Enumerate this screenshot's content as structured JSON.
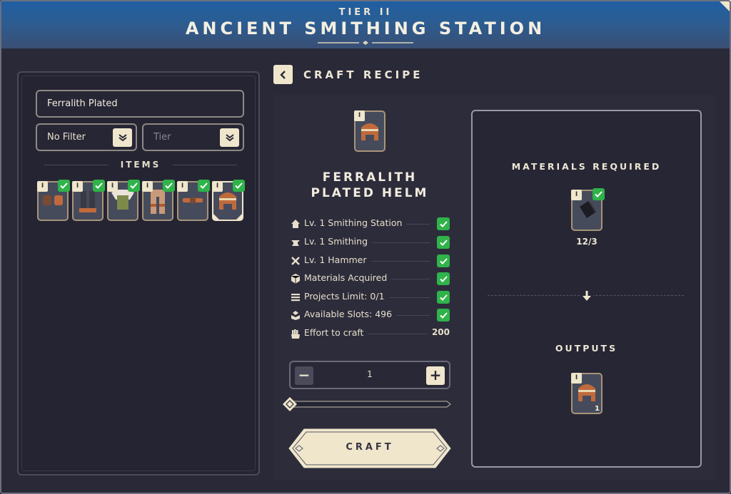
{
  "header": {
    "tier": "TIER II",
    "title": "ANCIENT SMITHING STATION"
  },
  "left": {
    "search_value": "Ferralith Plated",
    "filter_value": "No Filter",
    "tier_placeholder": "Tier",
    "items_label": "ITEMS",
    "items": [
      {
        "tier": "I",
        "kind": "gloves-icon",
        "selected": false
      },
      {
        "tier": "I",
        "kind": "legs-icon",
        "selected": false
      },
      {
        "tier": "I",
        "kind": "chest-icon",
        "selected": false
      },
      {
        "tier": "I",
        "kind": "pants-icon",
        "selected": false
      },
      {
        "tier": "I",
        "kind": "belt-icon",
        "selected": false
      },
      {
        "tier": "I",
        "kind": "helm-icon",
        "selected": true
      }
    ]
  },
  "recipe": {
    "heading": "CRAFT RECIPE",
    "item_tier": "I",
    "item_name_line1": "FERRALITH",
    "item_name_line2": "PLATED HELM",
    "requirements": [
      {
        "icon": "house-icon",
        "label": "Lv. 1 Smithing Station",
        "met": true
      },
      {
        "icon": "anvil-icon",
        "label": "Lv. 1 Smithing",
        "met": true
      },
      {
        "icon": "crossed-tools-icon",
        "label": "Lv. 1 Hammer",
        "met": true
      },
      {
        "icon": "box-icon",
        "label": "Materials Acquired",
        "met": true
      },
      {
        "icon": "list-icon",
        "label": "Projects Limit: 0/1",
        "met": true
      },
      {
        "icon": "slots-icon",
        "label": "Available Slots: 496",
        "met": true
      },
      {
        "icon": "fist-icon",
        "label": "Effort to craft",
        "value": "200"
      }
    ],
    "quantity": "1",
    "slider_fraction": 0,
    "craft_label": "CRAFT"
  },
  "materials": {
    "title": "MATERIALS REQUIRED",
    "item_tier": "I",
    "count": "12/3",
    "outputs_title": "OUTPUTS",
    "output_tier": "I",
    "output_qty": "1"
  },
  "colors": {
    "accent": "#efe6cc",
    "ok": "#2fb34a",
    "header": "#1f5fa3"
  }
}
